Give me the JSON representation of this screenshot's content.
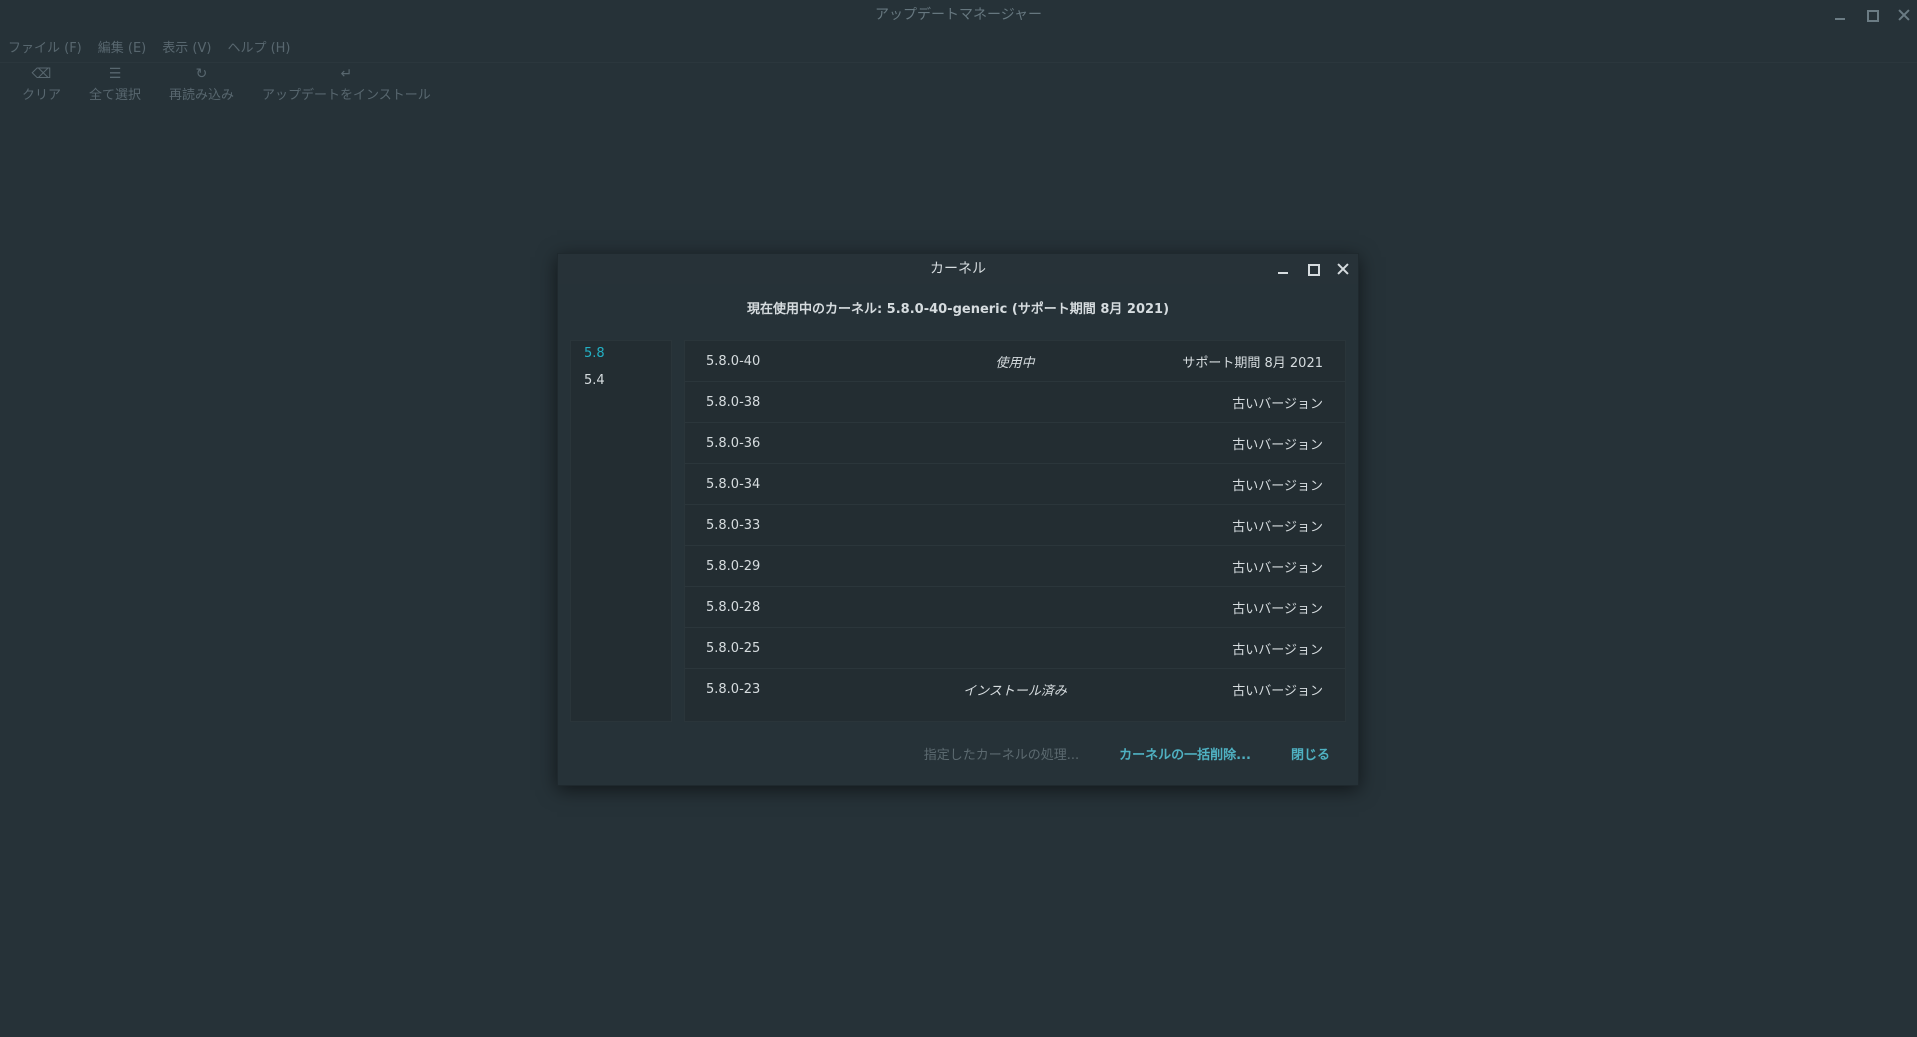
{
  "window": {
    "title": "アップデートマネージャー"
  },
  "menubar": [
    "ファイル (F)",
    "編集 (E)",
    "表示 (V)",
    "ヘルプ (H)"
  ],
  "toolbar": [
    {
      "label": "クリア",
      "icon": "clear-icon"
    },
    {
      "label": "全て選択",
      "icon": "select-all-icon"
    },
    {
      "label": "再読み込み",
      "icon": "refresh-icon"
    },
    {
      "label": "アップデートをインストール",
      "icon": "install-icon"
    }
  ],
  "dialog": {
    "title": "カーネル",
    "current_kernel": "現在使用中のカーネル: 5.8.0-40-generic (サポート期間 8月 2021)",
    "versions": [
      {
        "label": "5.8",
        "active": true
      },
      {
        "label": "5.4",
        "active": false
      }
    ],
    "kernels": [
      {
        "version": "5.8.0-40",
        "status": "使用中",
        "support": "サポート期間 8月 2021"
      },
      {
        "version": "5.8.0-38",
        "status": "",
        "support": "古いバージョン"
      },
      {
        "version": "5.8.0-36",
        "status": "",
        "support": "古いバージョン"
      },
      {
        "version": "5.8.0-34",
        "status": "",
        "support": "古いバージョン"
      },
      {
        "version": "5.8.0-33",
        "status": "",
        "support": "古いバージョン"
      },
      {
        "version": "5.8.0-29",
        "status": "",
        "support": "古いバージョン"
      },
      {
        "version": "5.8.0-28",
        "status": "",
        "support": "古いバージョン"
      },
      {
        "version": "5.8.0-25",
        "status": "",
        "support": "古いバージョン"
      },
      {
        "version": "5.8.0-23",
        "status": "インストール済み",
        "support": "古いバージョン"
      }
    ],
    "buttons": {
      "process": "指定したカーネルの処理...",
      "bulk_remove": "カーネルの一括削除...",
      "close": "閉じる"
    }
  }
}
